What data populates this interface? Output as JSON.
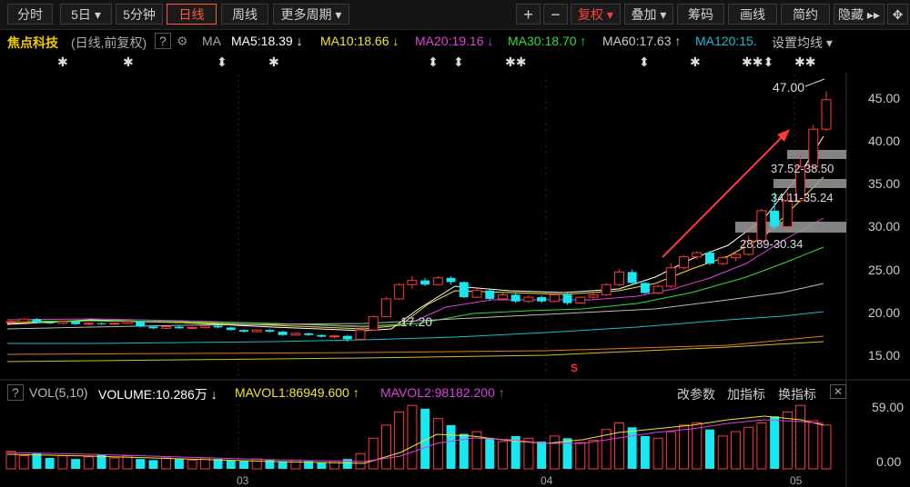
{
  "toolbar": {
    "left": [
      "分时",
      "5日 ▾",
      "5分钟",
      "日线",
      "周线",
      "更多周期 ▾"
    ],
    "right": [
      "+",
      "−",
      "复权 ▾",
      "叠加 ▾",
      "筹码",
      "画线",
      "简约",
      "隐藏 ▸▸",
      "✥"
    ]
  },
  "ma": {
    "stock_name": "焦点科技",
    "period": "(日线,前复权)",
    "help": "?",
    "gear": "⚙",
    "label": "MA",
    "ma5": "MA5:18.39 ↓",
    "ma10": "MA10:18.66 ↓",
    "ma20": "MA20:19.16 ↓",
    "ma30": "MA30:18.70 ↑",
    "ma60": "MA60:17.63 ↑",
    "ma120": "MA120:15.",
    "settings": "设置均线 ▾"
  },
  "events": {
    "e1": "✱",
    "e2": "✱",
    "e3": "⬍",
    "e4": "✱",
    "e5": "⬍",
    "e6": "⬍",
    "e7": "✱✱",
    "e8": "⬍",
    "e9": "✱",
    "e10": "✱✱⬍",
    "e11": "✱✱"
  },
  "annotations": {
    "high": "47.00",
    "low": "17.20",
    "z1": "37.52-38.50",
    "z2": "34.11-35.24",
    "z3": "28.89-30.34",
    "signal": "S"
  },
  "price_axis": [
    "45.00",
    "40.00",
    "35.00",
    "30.00",
    "25.00",
    "20.00",
    "15.00"
  ],
  "vol": {
    "help": "?",
    "name": "VOL(5,10)",
    "volume": "VOLUME:10.286万 ↓",
    "mavol1": "MAVOL1:86949.600 ↑",
    "mavol2": "MAVOL2:98182.200 ↑",
    "btn_params": "改参数",
    "btn_add": "加指标",
    "btn_switch": "换指标",
    "close": "✕"
  },
  "vol_axis": [
    "59.00",
    "0.00"
  ],
  "x_axis": [
    "03",
    "04",
    "05"
  ],
  "colors": {
    "up": "#ff3a3a",
    "down": "#18e6f0",
    "ma5": "#ffffff",
    "ma10": "#f5e230",
    "ma20": "#e040e0",
    "ma30": "#30e030",
    "ma60": "#bbbbbb",
    "ma120": "#10c0d0"
  },
  "chart_data": {
    "type": "candlestick",
    "ylim": [
      13,
      49
    ],
    "candles": [
      [
        19.5,
        19.6,
        19.3,
        19.7
      ],
      [
        19.6,
        19.9,
        19.5,
        20.0
      ],
      [
        19.9,
        19.5,
        19.4,
        20.0
      ],
      [
        19.5,
        19.4,
        19.3,
        19.6
      ],
      [
        19.4,
        19.6,
        19.3,
        19.7
      ],
      [
        19.6,
        19.3,
        19.2,
        19.7
      ],
      [
        19.3,
        19.4,
        19.2,
        19.5
      ],
      [
        19.4,
        19.3,
        19.2,
        19.5
      ],
      [
        19.3,
        19.4,
        19.2,
        19.5
      ],
      [
        19.4,
        19.6,
        19.3,
        19.7
      ],
      [
        19.6,
        19.0,
        18.9,
        19.7
      ],
      [
        19.0,
        18.8,
        18.7,
        19.1
      ],
      [
        18.8,
        19.0,
        18.7,
        19.1
      ],
      [
        19.0,
        18.8,
        18.7,
        19.1
      ],
      [
        18.8,
        18.9,
        18.7,
        19.0
      ],
      [
        18.9,
        19.1,
        18.8,
        19.2
      ],
      [
        19.1,
        18.9,
        18.8,
        19.2
      ],
      [
        18.9,
        18.6,
        18.5,
        19.0
      ],
      [
        18.6,
        18.4,
        18.3,
        18.7
      ],
      [
        18.4,
        18.6,
        18.3,
        18.7
      ],
      [
        18.6,
        18.4,
        18.3,
        18.7
      ],
      [
        18.4,
        18.0,
        17.9,
        18.5
      ],
      [
        18.0,
        18.2,
        17.9,
        18.3
      ],
      [
        18.2,
        18.0,
        17.9,
        18.3
      ],
      [
        18.0,
        17.8,
        17.7,
        18.1
      ],
      [
        17.8,
        17.9,
        17.6,
        18.0
      ],
      [
        17.9,
        17.5,
        17.2,
        18.0
      ],
      [
        17.5,
        18.6,
        17.5,
        18.7
      ],
      [
        18.6,
        20.2,
        18.5,
        20.3
      ],
      [
        20.2,
        22.3,
        20.1,
        22.5
      ],
      [
        22.3,
        24.0,
        22.2,
        24.2
      ],
      [
        24.0,
        24.5,
        23.5,
        25.0
      ],
      [
        24.5,
        24.0,
        23.8,
        24.8
      ],
      [
        24.0,
        24.8,
        23.9,
        25.0
      ],
      [
        24.8,
        24.3,
        24.0,
        25.0
      ],
      [
        24.3,
        22.5,
        22.4,
        24.4
      ],
      [
        22.5,
        23.3,
        22.4,
        23.5
      ],
      [
        23.3,
        22.3,
        22.1,
        23.4
      ],
      [
        22.3,
        22.8,
        22.1,
        23.0
      ],
      [
        22.8,
        22.0,
        21.8,
        23.0
      ],
      [
        22.0,
        22.5,
        21.8,
        22.7
      ],
      [
        22.5,
        22.0,
        21.8,
        22.7
      ],
      [
        22.0,
        22.8,
        21.9,
        23.0
      ],
      [
        22.8,
        21.8,
        21.6,
        23.0
      ],
      [
        21.8,
        22.5,
        21.7,
        22.6
      ],
      [
        22.5,
        22.8,
        22.3,
        23.0
      ],
      [
        22.8,
        24.0,
        22.6,
        24.2
      ],
      [
        24.0,
        25.5,
        23.8,
        25.8
      ],
      [
        25.5,
        24.2,
        24.0,
        25.8
      ],
      [
        24.2,
        23.0,
        22.9,
        24.3
      ],
      [
        23.0,
        23.8,
        22.8,
        24.0
      ],
      [
        23.8,
        26.0,
        23.6,
        26.5
      ],
      [
        26.0,
        27.3,
        25.8,
        27.5
      ],
      [
        27.3,
        27.8,
        27.0,
        28.0
      ],
      [
        27.8,
        26.5,
        26.3,
        28.0
      ],
      [
        26.5,
        27.2,
        26.3,
        27.4
      ],
      [
        27.2,
        27.6,
        26.8,
        28.0
      ],
      [
        27.6,
        29.2,
        27.4,
        29.8
      ],
      [
        29.2,
        32.8,
        29.0,
        33.0
      ],
      [
        32.8,
        30.9,
        30.5,
        35.0
      ],
      [
        30.9,
        34.0,
        30.8,
        35.0
      ],
      [
        34.0,
        38.0,
        33.8,
        39.5
      ],
      [
        38.0,
        42.5,
        37.8,
        43.0
      ],
      [
        42.5,
        46.0,
        42.3,
        47.0
      ]
    ],
    "volumes": [
      16,
      12,
      14,
      10,
      12,
      9,
      11,
      13,
      10,
      12,
      9,
      8,
      10,
      9,
      8,
      10,
      9,
      8,
      7,
      9,
      8,
      7,
      8,
      7,
      6,
      7,
      9,
      14,
      28,
      40,
      52,
      58,
      55,
      46,
      40,
      32,
      34,
      28,
      25,
      30,
      28,
      25,
      30,
      28,
      24,
      26,
      36,
      42,
      38,
      30,
      28,
      34,
      40,
      42,
      36,
      30,
      34,
      38,
      42,
      48,
      52,
      58,
      44,
      40
    ]
  }
}
